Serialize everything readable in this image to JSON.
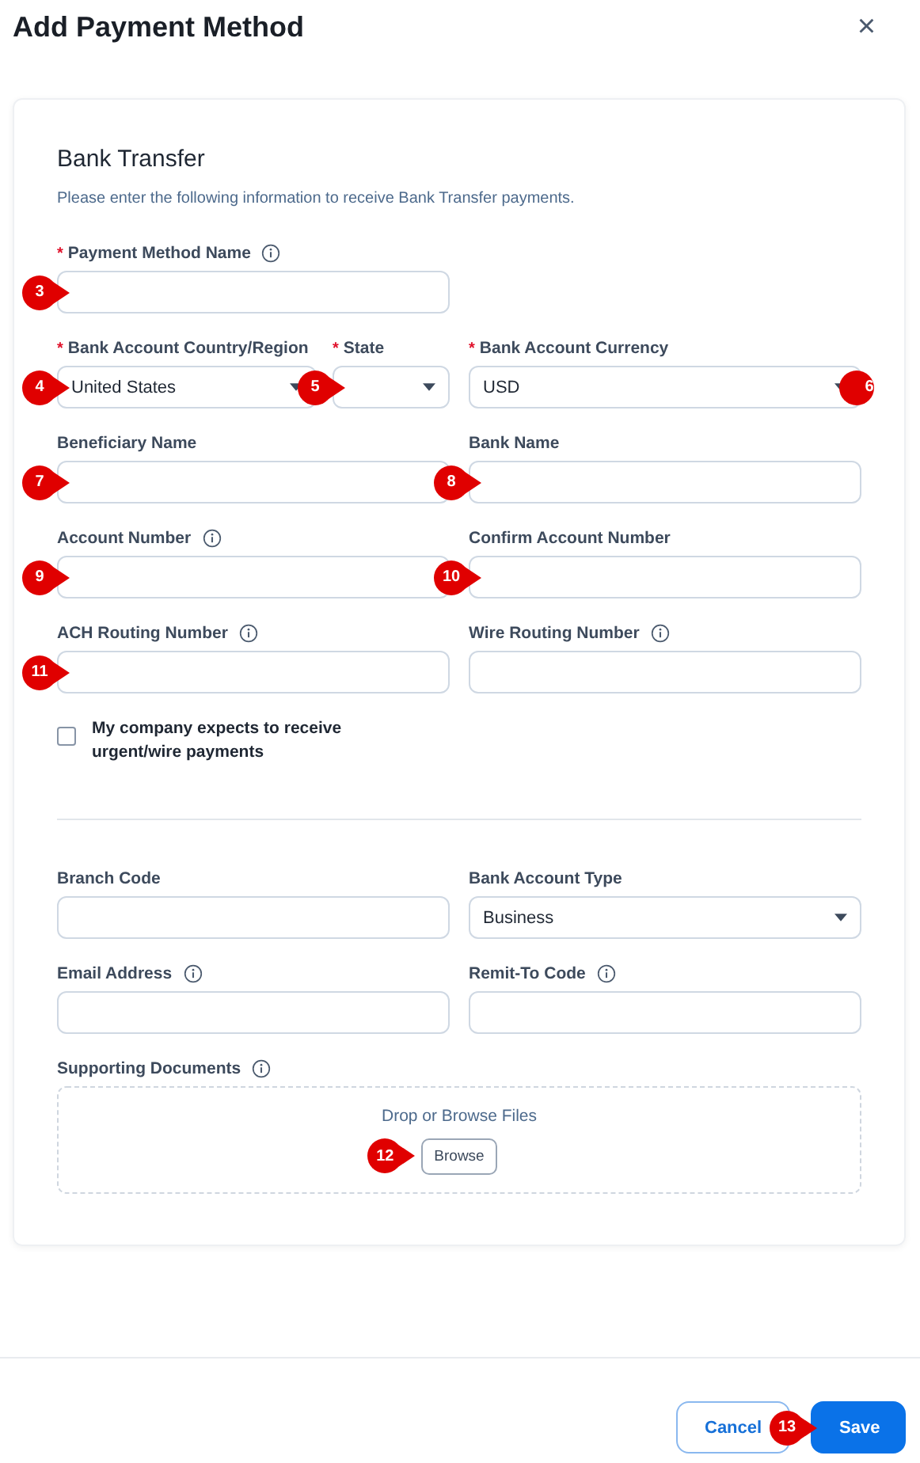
{
  "dialog": {
    "title": "Add Payment Method",
    "close": "×"
  },
  "form": {
    "section_title": "Bank Transfer",
    "description": "Please enter the following information to receive Bank Transfer payments.",
    "rows": [
      [
        [
          {
            "label": "Payment Method Name",
            "asterisk": "*",
            "info": true,
            "kind": "text",
            "marker": {
              "label": "3",
              "kind": "left"
            }
          }
        ],
        []
      ],
      [
        [
          {
            "label": "Bank Account Country/Region",
            "asterisk": "*",
            "info": false,
            "kind": "select",
            "value": "United States",
            "marker": {
              "label": "4",
              "kind": "left"
            }
          },
          {
            "label": "State",
            "asterisk": "*",
            "info": false,
            "kind": "select",
            "marker": {
              "label": "5",
              "kind": "left"
            }
          }
        ],
        [
          {
            "label": "Bank Account Currency",
            "asterisk": "*",
            "info": false,
            "kind": "select",
            "value": "USD",
            "marker": {
              "label": "6",
              "kind": "right"
            }
          }
        ]
      ],
      [
        [
          {
            "label": "Beneficiary Name",
            "info": false,
            "kind": "text",
            "marker": {
              "label": "7",
              "kind": "left"
            }
          }
        ],
        [
          {
            "label": "Bank Name",
            "info": false,
            "kind": "text",
            "marker": {
              "label": "8",
              "kind": "left"
            }
          }
        ]
      ],
      [
        [
          {
            "label": "Account Number",
            "info": true,
            "kind": "text",
            "marker": {
              "label": "9",
              "kind": "left"
            }
          }
        ],
        [
          {
            "label": "Confirm Account Number",
            "info": false,
            "kind": "text",
            "marker": {
              "label": "10",
              "kind": "left"
            }
          }
        ]
      ],
      [
        [
          {
            "label": "ACH Routing Number",
            "info": true,
            "kind": "text",
            "marker": {
              "label": "11",
              "kind": "left"
            }
          }
        ],
        [
          {
            "label": "Wire Routing Number",
            "info": true,
            "kind": "text"
          }
        ]
      ]
    ],
    "checkbox": {
      "label": "My company expects to receive urgent/wire payments",
      "checked": false
    },
    "rows_2": [
      [
        [
          {
            "label": "Branch Code",
            "info": false,
            "kind": "text"
          }
        ],
        [
          {
            "label": "Bank Account Type",
            "info": false,
            "kind": "select",
            "value": "Business"
          }
        ]
      ],
      [
        [
          {
            "label": "Email Address",
            "info": true,
            "kind": "text"
          }
        ],
        [
          {
            "label": "Remit-To Code",
            "info": true,
            "kind": "text"
          }
        ]
      ]
    ],
    "documents": {
      "label": "Supporting Documents",
      "info": true,
      "drop_text": "Drop or Browse Files",
      "button": "Browse",
      "marker": {
        "label": "12"
      }
    }
  },
  "footer": {
    "buttons": [
      {
        "label": "Cancel",
        "kind": "secondary"
      },
      {
        "label": "Save",
        "kind": "primary",
        "marker": {
          "label": "13"
        }
      }
    ]
  }
}
